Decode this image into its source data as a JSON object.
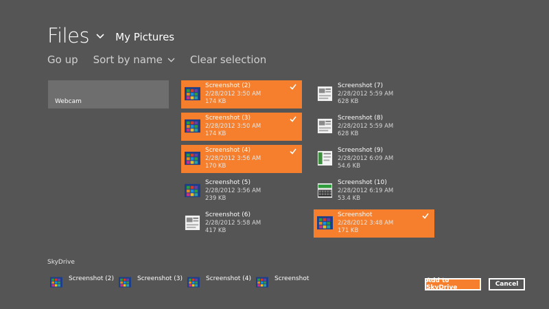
{
  "header": {
    "title": "Files",
    "location": "My Pictures"
  },
  "commands": {
    "go_up": "Go up",
    "sort": "Sort by name",
    "clear": "Clear selection"
  },
  "webcam": {
    "label": "Webcam"
  },
  "files": [
    {
      "name": "Screenshot (2)",
      "date": "2/28/2012 3:50 AM",
      "size": "174 KB",
      "selected": true,
      "thumb": "start-screen"
    },
    {
      "name": "Screenshot (3)",
      "date": "2/28/2012 3:50 AM",
      "size": "174 KB",
      "selected": true,
      "thumb": "start-screen"
    },
    {
      "name": "Screenshot (4)",
      "date": "2/28/2012 3:56 AM",
      "size": "170 KB",
      "selected": true,
      "thumb": "start-screen"
    },
    {
      "name": "Screenshot (5)",
      "date": "2/28/2012 3:56 AM",
      "size": "239 KB",
      "selected": false,
      "thumb": "start-screen"
    },
    {
      "name": "Screenshot (6)",
      "date": "2/28/2012 5:58 AM",
      "size": "417 KB",
      "selected": false,
      "thumb": "document"
    },
    {
      "name": "Screenshot (7)",
      "date": "2/28/2012 5:59 AM",
      "size": "628 KB",
      "selected": false,
      "thumb": "document"
    },
    {
      "name": "Screenshot (8)",
      "date": "2/28/2012 5:59 AM",
      "size": "628 KB",
      "selected": false,
      "thumb": "document"
    },
    {
      "name": "Screenshot (9)",
      "date": "2/28/2012 6:09 AM",
      "size": "54.6 KB",
      "selected": false,
      "thumb": "green-doc"
    },
    {
      "name": "Screenshot (10)",
      "date": "2/28/2012 6:19 AM",
      "size": "53.4 KB",
      "selected": false,
      "thumb": "keyboard"
    },
    {
      "name": "Screenshot",
      "date": "2/28/2012 3:48 AM",
      "size": "171 KB",
      "selected": true,
      "thumb": "start-screen"
    }
  ],
  "basket": {
    "label": "SkyDrive",
    "items": [
      "Screenshot (2)",
      "Screenshot (3)",
      "Screenshot (4)",
      "Screenshot"
    ]
  },
  "buttons": {
    "add": "Add to SkyDrive",
    "cancel": "Cancel"
  },
  "colors": {
    "background": "#555555",
    "accent": "#f57f2d",
    "webcam_tile": "#6e6e6e"
  }
}
